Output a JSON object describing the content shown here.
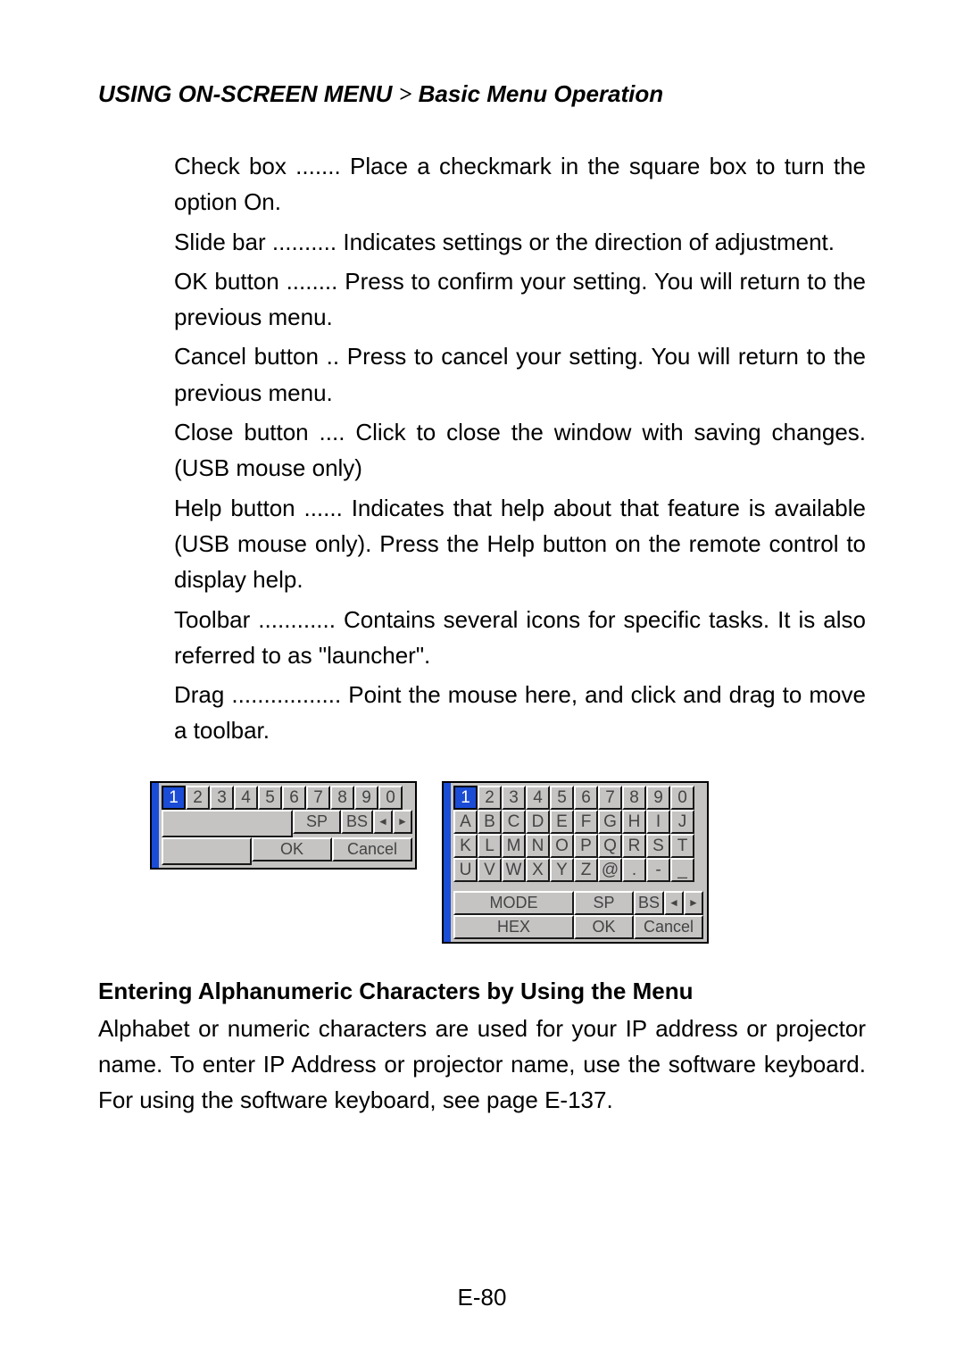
{
  "header": {
    "section": "USING ON-SCREEN MENU",
    "gt_symbol": ">",
    "subsection": "Basic Menu Operation"
  },
  "definitions": [
    {
      "term": "Check box",
      "dots": ".......",
      "desc": "Place a checkmark in the square box to turn the option On."
    },
    {
      "term": "Slide bar",
      "dots": "..........",
      "desc": "Indicates settings or the direction of adjustment."
    },
    {
      "term": "OK button",
      "dots": "........",
      "desc": "Press to confirm your setting. You will return to the previous menu."
    },
    {
      "term": "Cancel button",
      "dots": "..",
      "desc": "Press to cancel your setting. You will return to the previous menu."
    },
    {
      "term": "Close button",
      "dots": "....",
      "desc": "Click to close the window with saving changes. (USB mouse only)"
    },
    {
      "term": "Help button",
      "dots": "......",
      "desc": "Indicates that help about that feature is available (USB mouse only). Press the Help button on the remote control to display help."
    },
    {
      "term": "Toolbar",
      "dots": "............",
      "desc": "Contains several icons for specific tasks. It is also referred to as \"launcher\"."
    },
    {
      "term": "Drag",
      "dots": ".................",
      "desc": "Point the mouse here, and click and drag to move a toolbar."
    }
  ],
  "numeric_keypad": {
    "row": [
      "1",
      "2",
      "3",
      "4",
      "5",
      "6",
      "7",
      "8",
      "9",
      "0"
    ],
    "selected_index": 0,
    "sp": "SP",
    "bs": "BS",
    "left": "◄",
    "right": "►",
    "ok": "OK",
    "cancel": "Cancel"
  },
  "alpha_keypad": {
    "rows": [
      [
        "1",
        "2",
        "3",
        "4",
        "5",
        "6",
        "7",
        "8",
        "9",
        "0"
      ],
      [
        "A",
        "B",
        "C",
        "D",
        "E",
        "F",
        "G",
        "H",
        "I",
        "J"
      ],
      [
        "K",
        "L",
        "M",
        "N",
        "O",
        "P",
        "Q",
        "R",
        "S",
        "T"
      ],
      [
        "U",
        "V",
        "W",
        "X",
        "Y",
        "Z",
        "@",
        ".",
        "-",
        "_"
      ]
    ],
    "selected": [
      0,
      0
    ],
    "mode": "MODE",
    "hex": "HEX",
    "sp": "SP",
    "bs": "BS",
    "left": "◄",
    "right": "►",
    "ok": "OK",
    "cancel": "Cancel"
  },
  "subheading": "Entering Alphanumeric Characters by Using the Menu",
  "paragraph": "Alphabet or numeric characters are used for your IP address or projector name. To enter IP Address or projector name, use the software keyboard. For using the software keyboard, see page E-137.",
  "page_number": "E-80"
}
